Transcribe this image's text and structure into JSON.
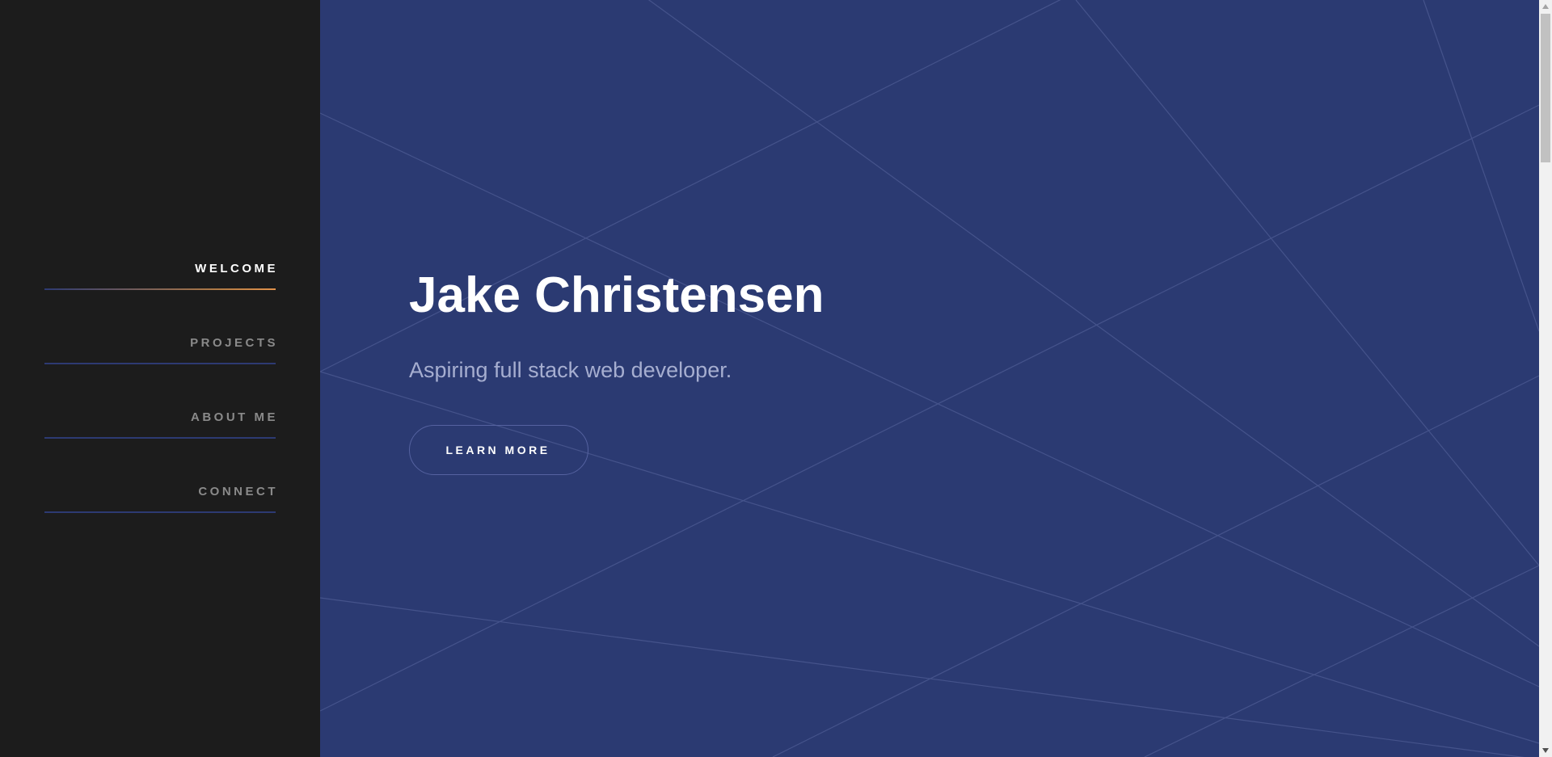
{
  "nav": {
    "items": [
      {
        "label": "WELCOME",
        "active": true
      },
      {
        "label": "PROJECTS",
        "active": false
      },
      {
        "label": "ABOUT ME",
        "active": false
      },
      {
        "label": "CONNECT",
        "active": false
      }
    ]
  },
  "hero": {
    "title": "Jake Christensen",
    "subtitle": "Aspiring full stack web developer.",
    "button_label": "LEARN MORE"
  },
  "colors": {
    "sidebar_bg": "#1c1c1c",
    "hero_bg": "#2b3a72",
    "active_accent": "#e2924b",
    "inactive_line": "#2d3a72"
  },
  "icons": {
    "scroll_up": "triangle-up-icon",
    "scroll_down": "triangle-down-icon"
  }
}
